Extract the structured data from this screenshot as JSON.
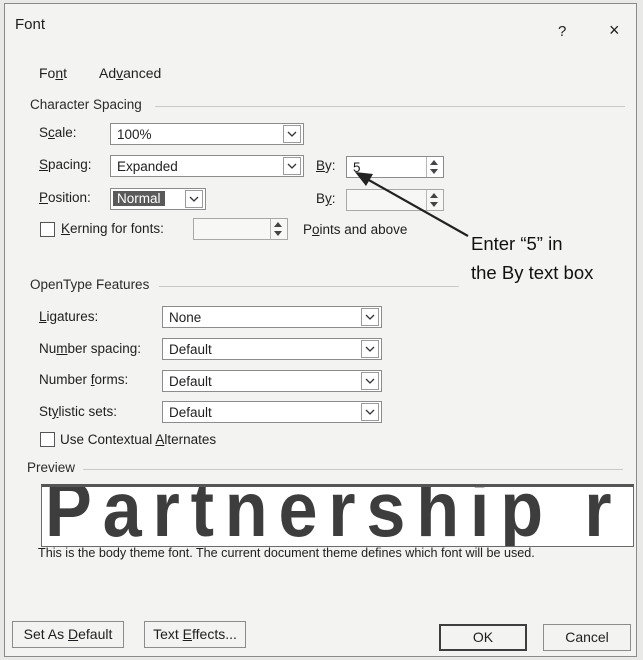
{
  "dialog": {
    "title": "Font",
    "help": "?",
    "close": "×"
  },
  "tabs": [
    {
      "pre": "Fo",
      "key": "n",
      "post": "t"
    },
    {
      "pre": "Ad",
      "key": "v",
      "post": "anced"
    }
  ],
  "character_spacing": {
    "heading": "Character Spacing",
    "scale": {
      "pre": "S",
      "key": "c",
      "post": "ale:",
      "value": "100%"
    },
    "spacing": {
      "pre": "",
      "key": "S",
      "post": "pacing:",
      "value": "Expanded"
    },
    "spacing_by": {
      "pre": "",
      "key": "B",
      "post": "y:",
      "value": "5"
    },
    "position": {
      "pre": "",
      "key": "P",
      "post": "osition:",
      "value": "Normal"
    },
    "position_by": {
      "pre": "B",
      "key": "y",
      "post": ":",
      "value": ""
    },
    "kerning": {
      "pre": "",
      "key": "K",
      "post": "erning for fonts:",
      "value": ""
    },
    "points": {
      "pre": "P",
      "key": "o",
      "post": "ints and above"
    }
  },
  "opentype": {
    "heading": "OpenType Features",
    "ligatures": {
      "pre": "",
      "key": "L",
      "post": "igatures:",
      "value": "None"
    },
    "number_spacing": {
      "pre": "Nu",
      "key": "m",
      "post": "ber spacing:",
      "value": "Default"
    },
    "number_forms": {
      "pre": "Number ",
      "key": "f",
      "post": "orms:",
      "value": "Default"
    },
    "stylistic_sets": {
      "pre": "St",
      "key": "y",
      "post": "listic sets:",
      "value": "Default"
    },
    "contextual": {
      "pre": "Use Contextual ",
      "key": "A",
      "post": "lternates"
    }
  },
  "preview": {
    "heading": "Preview",
    "sample": "Partnership r",
    "caption": "This is the body theme font. The current document theme defines which font will be used."
  },
  "buttons": {
    "default": {
      "pre": "Set As ",
      "key": "D",
      "post": "efault"
    },
    "effects": {
      "pre": "Text ",
      "key": "E",
      "post": "ffects..."
    },
    "ok": "OK",
    "cancel": "Cancel"
  },
  "annotation": {
    "line1": "Enter “5” in",
    "line2": "the By text box"
  }
}
